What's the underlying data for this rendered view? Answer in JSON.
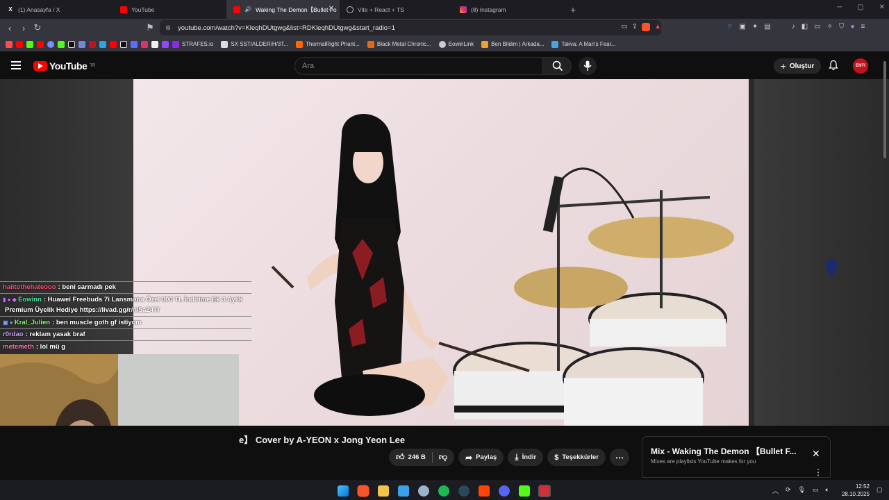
{
  "tabs": [
    {
      "title": "(1) Anasayfa / X",
      "icon": "x-icon"
    },
    {
      "title": "YouTube",
      "icon": "youtube-icon"
    },
    {
      "title": "Waking The Demon【Bullet Fo",
      "icon": "youtube-icon",
      "active": true
    },
    {
      "title": "Vite + React + TS",
      "icon": "globe-icon"
    },
    {
      "title": "(8) Instagram",
      "icon": "instagram-icon"
    }
  ],
  "address": {
    "url": "youtube.com/watch?v=KleqhDUtgwg&list=RDKleqhDUtgwg&start_radio=1"
  },
  "bookmarks": [
    {
      "label": "STRAFES.io",
      "color": "#8a2be2"
    },
    {
      "label": "SX SST/ALDER/H/3T...",
      "color": "#dddddd"
    },
    {
      "label": "ThermalRight Phant...",
      "color": "#ff6600"
    },
    {
      "label": "Black Metal Chronic...",
      "color": "#e06a1b"
    },
    {
      "label": "EowinLink",
      "color": "#cccccc"
    },
    {
      "label": "Ben Bildim | Arkada...",
      "color": "#f0a030"
    },
    {
      "label": "Takva: A Man's Fear...",
      "color": "#4aa3df"
    }
  ],
  "youtube": {
    "logo": "YouTube",
    "logo_region": "TR",
    "search_placeholder": "Ara",
    "create_label": "Oluştur",
    "avatar_text": "ENTI"
  },
  "chat": [
    {
      "user": "haiitothehateooo",
      "user_color": "#ff4d6d",
      "message": ": beni sarmadı pek"
    },
    {
      "user": "Eowinn",
      "user_color": "#4de3a0",
      "message": ": Huawei Freebuds 7i Lansmana Özel 900 TL İndirime Ek 3 Aylık"
    },
    {
      "user": "",
      "user_color": "#ffffff",
      "message": "Premium Üyelik Hediye https://livad.gg/r/nI5aZ4T/"
    },
    {
      "user": "Kral_Julien",
      "user_color": "#7cff6b",
      "message": ": ben muscle goth gf istiyom"
    },
    {
      "user": "r0rdao",
      "user_color": "#c9a0ff",
      "message": ": reklam yasak braf"
    },
    {
      "user": "metemeth",
      "user_color": "#ff6fb5",
      "message": ": lol mü g"
    }
  ],
  "video": {
    "title": "e】 Cover by A-YEON x Jong Yeon Lee",
    "likes": "246 B",
    "share": "Paylaş",
    "download": "İndir",
    "thanks": "Teşekkürler"
  },
  "mix": {
    "title": "Mix - Waking The Demon 【Bullet F...",
    "subtitle": "Mixes are playlists YouTube makes for you"
  },
  "clock": {
    "time": "12:52",
    "date": "28.10.2025"
  }
}
